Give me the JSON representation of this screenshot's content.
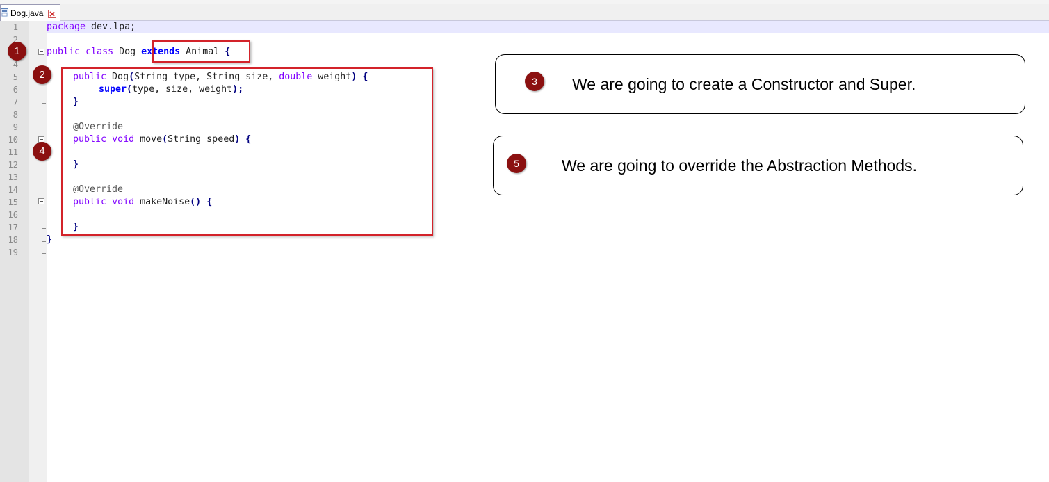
{
  "tab": {
    "label": "Dog.java",
    "icon": "java-file-icon",
    "close_icon": "close-tab-icon"
  },
  "line_numbers": [
    "1",
    "2",
    "3",
    "4",
    "5",
    "6",
    "7",
    "8",
    "9",
    "10",
    "11",
    "12",
    "13",
    "14",
    "15",
    "16",
    "17",
    "18",
    "19"
  ],
  "code": {
    "l1": {
      "kw": "package",
      "rest": " dev.lpa;"
    },
    "l3": {
      "kw1": "public",
      "kw2": "class",
      "name": " Dog ",
      "extends": "extends",
      "parent": " Animal",
      "brace": "{"
    },
    "l5": {
      "kw": "public",
      "ctor": " Dog",
      "p1": "(",
      "args": "String type, String size, ",
      "dbl": "double",
      "w": " weight",
      "p2": ")",
      "brace": "{"
    },
    "l6": {
      "super": "super",
      "p1": "(",
      "args": "type, size, weight",
      "p2": ")",
      "semi": ";"
    },
    "l7": {
      "brace": "}"
    },
    "l9": {
      "ann": "@Override"
    },
    "l10": {
      "kw1": "public",
      "kw2": "void",
      "name": " move",
      "p1": "(",
      "args": "String speed",
      "p2": ")",
      "brace": "{"
    },
    "l12": {
      "brace": "}"
    },
    "l14": {
      "ann": "@Override"
    },
    "l15": {
      "kw1": "public",
      "kw2": "void",
      "name": " makeNoise",
      "parens": "()",
      "brace": "{"
    },
    "l17": {
      "brace": "}"
    },
    "l18": {
      "brace": "}"
    }
  },
  "markers": [
    "1",
    "2",
    "3",
    "4",
    "5"
  ],
  "callouts": {
    "c3": "We are going to create a Constructor and Super.",
    "c5": "We are going to override the Abstraction Methods."
  },
  "colors": {
    "marker": "#8b1010",
    "highlight_box": "#d3232a",
    "keyword": "#8000ff",
    "bold_keyword": "#0000ff",
    "operator": "#000080"
  }
}
